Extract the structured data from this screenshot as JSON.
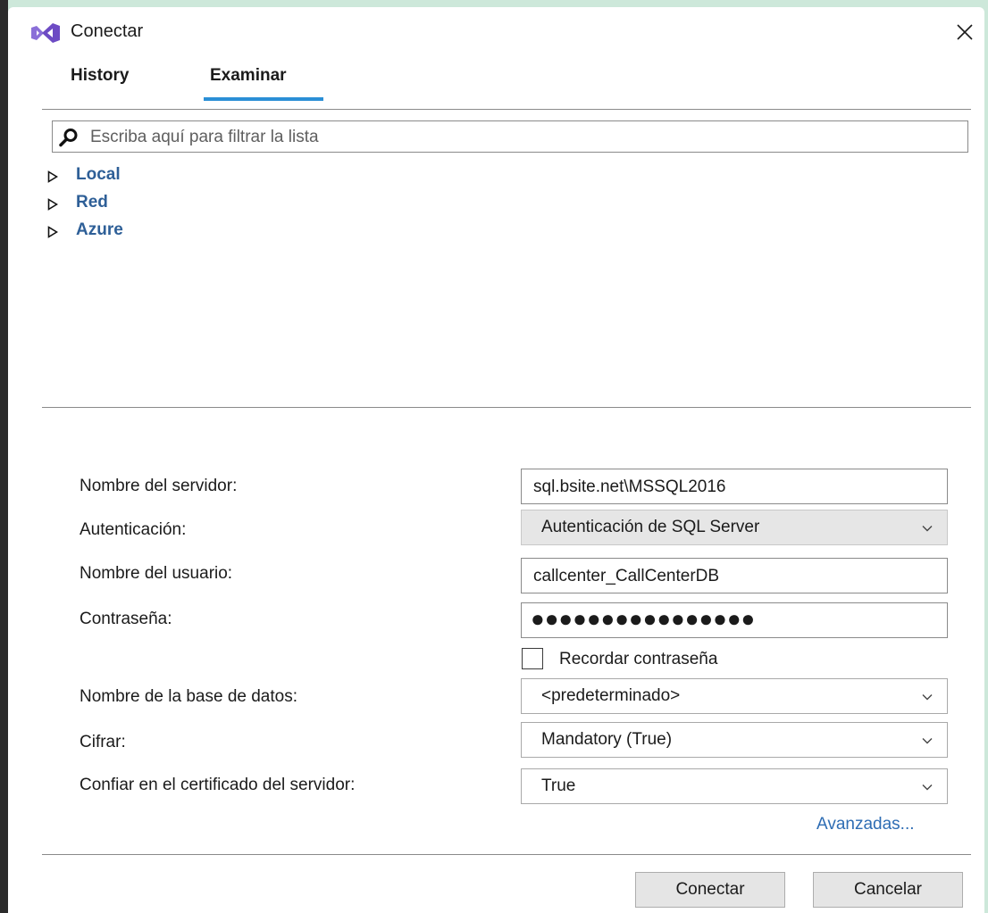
{
  "window": {
    "title": "Conectar",
    "logo_icon": "visual-studio-logo",
    "close_icon": "close-icon"
  },
  "tabs": [
    {
      "label": "History",
      "active": false
    },
    {
      "label": "Examinar",
      "active": true
    }
  ],
  "accent_color": "#2a8fd6",
  "filter": {
    "placeholder": "Escriba aquí para filtrar la lista",
    "value": ""
  },
  "tree": [
    {
      "label": "Local"
    },
    {
      "label": "Red"
    },
    {
      "label": "Azure"
    }
  ],
  "form": {
    "server_label": "Nombre del servidor:",
    "server_value": "sql.bsite.net\\MSSQL2016",
    "auth_label": "Autenticación:",
    "auth_value": "Autenticación de SQL Server",
    "user_label": "Nombre del usuario:",
    "user_value": "callcenter_CallCenterDB",
    "password_label": "Contraseña:",
    "password_mask": "●●●●●●●●●●●●●●●●",
    "remember_label": "Recordar contraseña",
    "remember_checked": false,
    "database_label": "Nombre de la base de datos:",
    "database_value": "<predeterminado>",
    "encrypt_label": "Cifrar:",
    "encrypt_value": "Mandatory (True)",
    "trust_label": "Confiar en el certificado del servidor:",
    "trust_value": "True"
  },
  "advanced_link": "Avanzadas...",
  "buttons": {
    "connect": "Conectar",
    "cancel": "Cancelar"
  }
}
